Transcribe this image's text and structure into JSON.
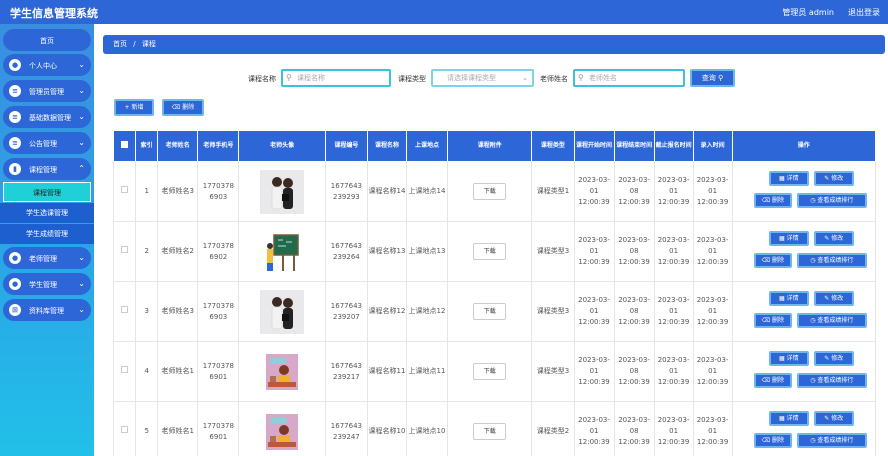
{
  "app": {
    "title": "学生信息管理系统",
    "admin_label": "管理员 admin",
    "logout_label": "退出登录"
  },
  "sidebar": {
    "home": "首页",
    "items": [
      {
        "label": "个人中心",
        "icon": "user-icon"
      },
      {
        "label": "管理员管理",
        "icon": "list-icon"
      },
      {
        "label": "基础数据管理",
        "icon": "list-icon"
      },
      {
        "label": "公告管理",
        "icon": "list-icon"
      },
      {
        "label": "课程管理",
        "icon": "chart-icon"
      },
      {
        "label": "老师管理",
        "icon": "user-icon"
      },
      {
        "label": "学生管理",
        "icon": "user-icon"
      },
      {
        "label": "资料库管理",
        "icon": "grid-icon"
      }
    ],
    "submenu": [
      "课程管理",
      "学生选课管理",
      "学生成绩管理"
    ]
  },
  "breadcrumb": {
    "home": "首页",
    "sep": "/",
    "current": "课程"
  },
  "filters": {
    "course_name_label": "课程名称",
    "course_name_placeholder": "课程名称",
    "course_type_label": "课程类型",
    "course_type_placeholder": "请选择课程类型",
    "teacher_name_label": "老师姓名",
    "teacher_name_placeholder": "老师姓名",
    "search_label": "查询"
  },
  "toolbar": {
    "add_label": "+ 新增",
    "delete_label": "删除"
  },
  "table": {
    "headers": [
      "索引",
      "老师姓名",
      "老师手机号",
      "老师头像",
      "课程编号",
      "课程名称",
      "上课地点",
      "课程附件",
      "课程类型",
      "课程开始时间",
      "课程结束时间",
      "截止报名时间",
      "录入时间",
      "操作"
    ],
    "download_label": "下载",
    "detail_label": "详情",
    "edit_label": "修改",
    "delete_label": "删除",
    "rank_label": "查看成绩排行",
    "rows": [
      {
        "index": "1",
        "teacher": "老师姓名3",
        "phone": "17703786903",
        "avatar": "photo",
        "code": "1677643239293",
        "name": "课程名称14",
        "place": "上课地点14",
        "type": "课程类型1",
        "start": "2023-03-01 12:00:39",
        "end": "2023-03-08 12:00:39",
        "deadline": "2023-03-01 12:00:39",
        "created": "2023-03-01 12:00:39"
      },
      {
        "index": "2",
        "teacher": "老师姓名2",
        "phone": "17703786902",
        "avatar": "board",
        "code": "1677643239264",
        "name": "课程名称13",
        "place": "上课地点13",
        "type": "课程类型3",
        "start": "2023-03-01 12:00:39",
        "end": "2023-03-08 12:00:39",
        "deadline": "2023-03-01 12:00:39",
        "created": "2023-03-01 12:00:39"
      },
      {
        "index": "3",
        "teacher": "老师姓名3",
        "phone": "17703786903",
        "avatar": "photo",
        "code": "1677643239207",
        "name": "课程名称12",
        "place": "上课地点12",
        "type": "课程类型3",
        "start": "2023-03-01 12:00:39",
        "end": "2023-03-08 12:00:39",
        "deadline": "2023-03-01 12:00:39",
        "created": "2023-03-01 12:00:39"
      },
      {
        "index": "4",
        "teacher": "老师姓名1",
        "phone": "17703786901",
        "avatar": "book",
        "code": "1677643239217",
        "name": "课程名称11",
        "place": "上课地点11",
        "type": "课程类型3",
        "start": "2023-03-01 12:00:39",
        "end": "2023-03-08 12:00:39",
        "deadline": "2023-03-01 12:00:39",
        "created": "2023-03-01 12:00:39"
      },
      {
        "index": "5",
        "teacher": "老师姓名1",
        "phone": "17703786901",
        "avatar": "book",
        "code": "1677643239247",
        "name": "课程名称10",
        "place": "上课地点10",
        "type": "课程类型2",
        "start": "2023-03-01 12:00:39",
        "end": "2023-03-08 12:00:39",
        "deadline": "2023-03-01 12:00:39",
        "created": "2023-03-01 12:00:39"
      }
    ]
  },
  "colors": {
    "primary": "#2d66d6",
    "accent": "#20d0d8"
  }
}
